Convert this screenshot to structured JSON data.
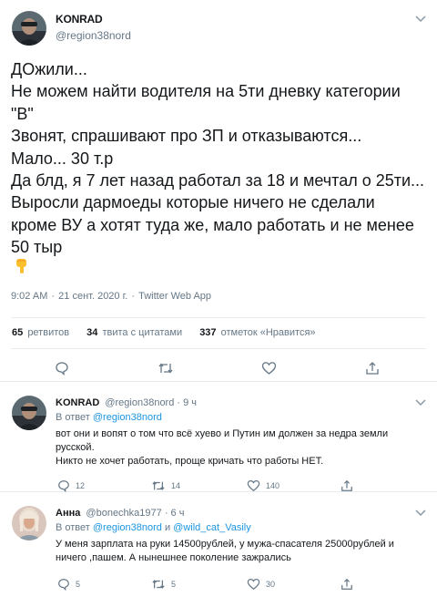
{
  "main_tweet": {
    "author_name": "KONRAD",
    "author_handle": "@region38nord",
    "text_lines": [
      "ДОжили...",
      "Не можем найти водителя на 5ти дневку категории",
      "\"В\"",
      "Звонят, спрашивают про ЗП и отказываются...",
      "Мало... 30 т.р",
      "Да блд, я 7 лет назад работал за 18 и мечтал о 25ти...",
      "Выросли дармоеды которые ничего не сделали",
      "кроме ВУ а хотят туда же, мало работать и не менее",
      "50 тыр"
    ],
    "emoji": "pointing-down-hand",
    "time": "9:02 AM",
    "date": "21 сент. 2020 г.",
    "source": "Twitter Web App",
    "separator": "·",
    "stats": {
      "retweets_count": "65",
      "retweets_label": "ретвитов",
      "quotes_count": "34",
      "quotes_label": "твита с цитатами",
      "likes_count": "337",
      "likes_label": "отметок «Нравится»"
    }
  },
  "replies": [
    {
      "author_name": "KONRAD",
      "author_handle": "@region38nord",
      "time_ago": "· 9 ч",
      "replying_prefix": "В ответ",
      "replying_to": "@region38nord",
      "replying_and": "",
      "replying_to_2": "",
      "text_lines": [
        "вот они и вопят о том что всё хуево и Путин им должен за недра земли",
        "русской.",
        "Никто не хочет работать, проще кричать что работы НЕТ."
      ],
      "reply_count": "12",
      "retweet_count": "14",
      "like_count": "140"
    },
    {
      "author_name": "Анна",
      "author_handle": "@bonechka1977",
      "time_ago": "· 6 ч",
      "replying_prefix": "В ответ",
      "replying_to": "@region38nord",
      "replying_and": "и",
      "replying_to_2": "@wild_cat_Vasily",
      "text_lines": [
        "У меня зарплата на руки 14500рублей, у мужа-спасателя 25000рублей  и",
        "ничего ,пашем. А нынешнее поколение зажрались"
      ],
      "reply_count": "5",
      "retweet_count": "5",
      "like_count": "30"
    }
  ],
  "icons": {
    "reply": "reply-icon",
    "retweet": "retweet-icon",
    "like": "heart-icon",
    "share": "share-icon",
    "more": "chevron-down-icon"
  },
  "colors": {
    "text": "#14171a",
    "secondary": "#657786",
    "link": "#1b95e0",
    "divider": "#e6ecf0"
  }
}
